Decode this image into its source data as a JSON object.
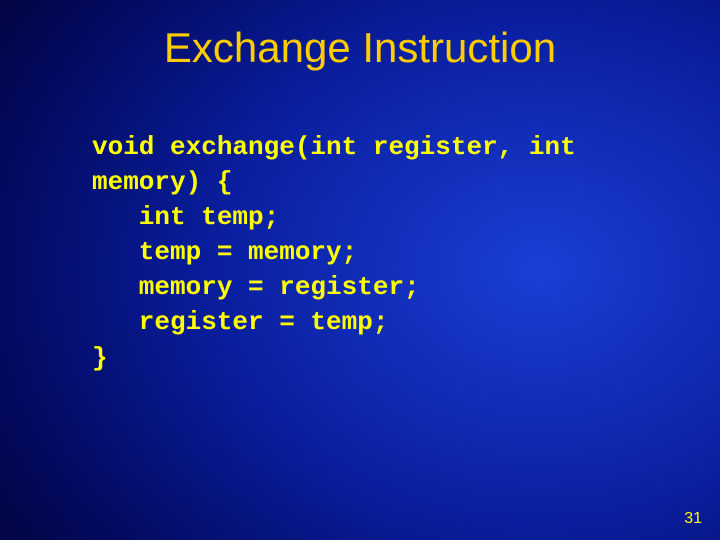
{
  "slide": {
    "title": "Exchange Instruction",
    "code": {
      "line1": "void exchange(int register, int",
      "line2": "memory) {",
      "line3": "   int temp;",
      "line4": "   temp = memory;",
      "line5": "   memory = register;",
      "line6": "   register = temp;",
      "line7": "}"
    },
    "page_number": "31"
  }
}
